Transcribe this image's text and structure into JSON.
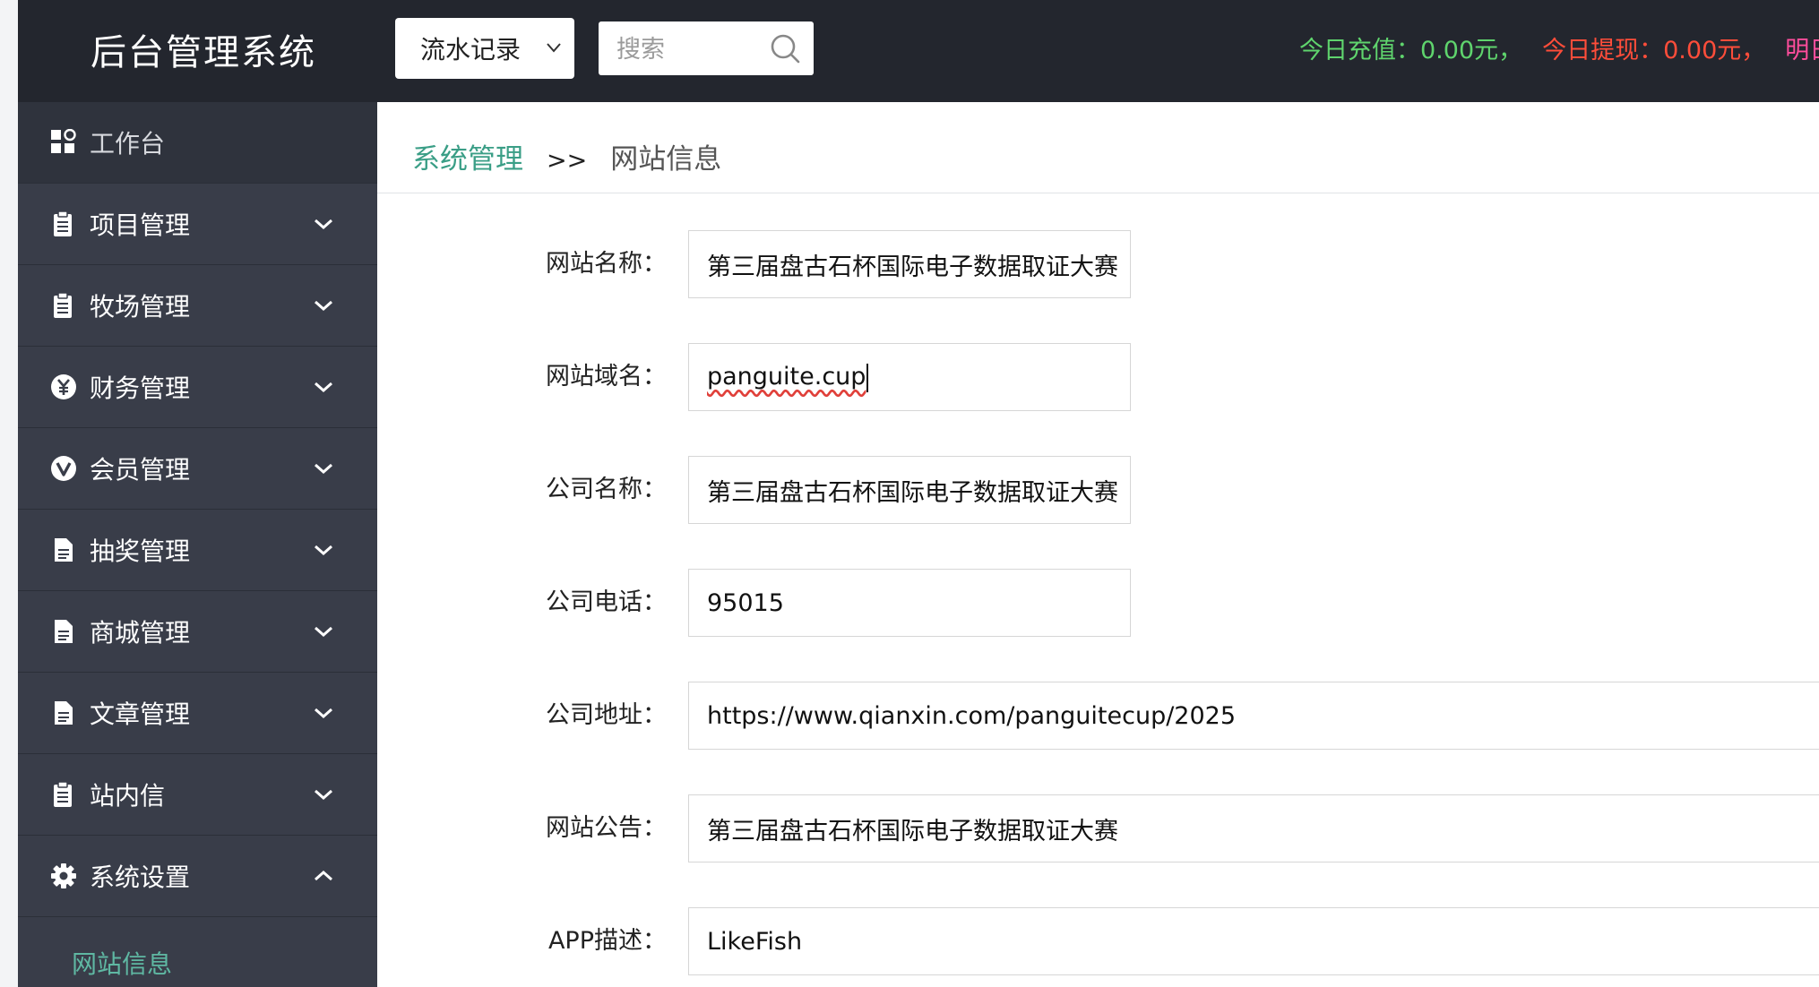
{
  "header": {
    "title": "后台管理系统",
    "select_value": "流水记录",
    "search_placeholder": "搜索",
    "stat_recharge": "今日充值：0.00元，",
    "stat_withdraw": "今日提现：0.00元，",
    "stat_tomorrow": "明日到"
  },
  "sidebar": {
    "items": [
      {
        "label": "工作台",
        "icon": "dashboard-icon"
      },
      {
        "label": "项目管理",
        "icon": "clipboard-icon"
      },
      {
        "label": "牧场管理",
        "icon": "clipboard-icon"
      },
      {
        "label": "财务管理",
        "icon": "yen-icon"
      },
      {
        "label": "会员管理",
        "icon": "vip-icon"
      },
      {
        "label": "抽奖管理",
        "icon": "document-icon"
      },
      {
        "label": "商城管理",
        "icon": "document-icon"
      },
      {
        "label": "文章管理",
        "icon": "document-icon"
      },
      {
        "label": "站内信",
        "icon": "clipboard-icon"
      },
      {
        "label": "系统设置",
        "icon": "gear-icon"
      }
    ],
    "sub_item": "网站信息"
  },
  "breadcrumb": {
    "parent": "系统管理",
    "separator": ">>",
    "current": "网站信息"
  },
  "form": {
    "site_name_label": "网站名称：",
    "site_name_value": "第三届盘古石杯国际电子数据取证大赛",
    "domain_label": "网站域名：",
    "domain_value": "panguite.cup",
    "company_name_label": "公司名称：",
    "company_name_value": "第三届盘古石杯国际电子数据取证大赛",
    "phone_label": "公司电话：",
    "phone_value": "95015",
    "address_label": "公司地址：",
    "address_value": "https://www.qianxin.com/panguitecup/2025",
    "notice_label": "网站公告：",
    "notice_value": "第三届盘古石杯国际电子数据取证大赛",
    "app_desc_label": "APP描述：",
    "app_desc_value": "LikeFish"
  },
  "colors": {
    "topbar": "#23262e",
    "sidebar": "#393d49",
    "accent_green": "#3a9e86",
    "stat_green": "#5fd46d",
    "stat_red": "#ff4d3a",
    "stat_pink": "#ff4d9c"
  }
}
